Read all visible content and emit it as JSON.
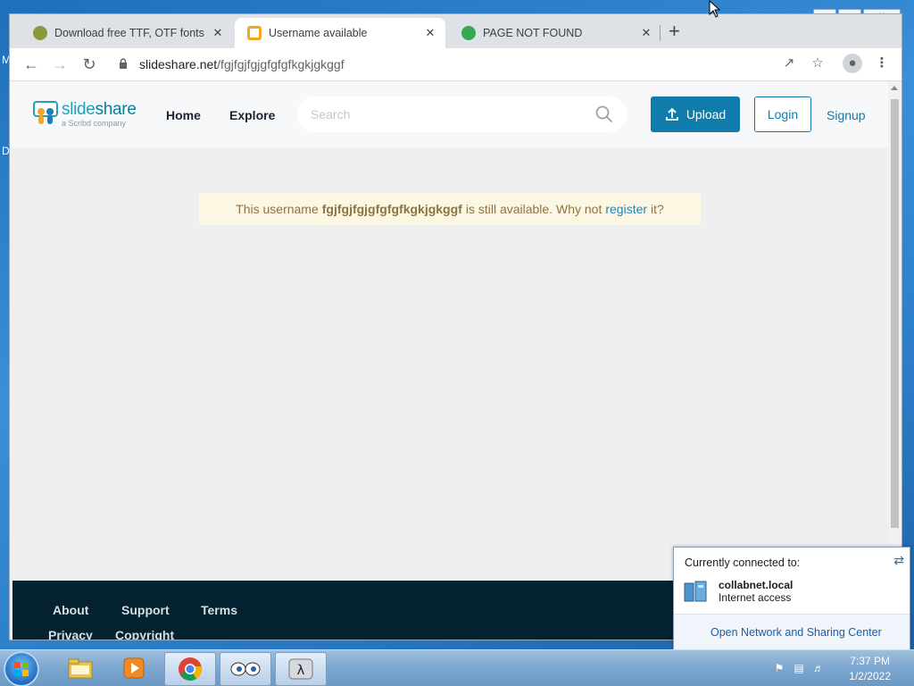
{
  "desktop": {
    "left_letters": [
      "M",
      "D"
    ]
  },
  "browser": {
    "tabs": [
      {
        "title": "Download free TTF, OTF fonts | C",
        "favicon_color": "#8a9a3a",
        "active": false
      },
      {
        "title": "Username available",
        "favicon_color": "#f5a623",
        "active": true
      },
      {
        "title": "PAGE NOT FOUND",
        "favicon_color": "#34a853",
        "active": false
      }
    ],
    "new_tab": "+",
    "url_domain": "slideshare.net",
    "url_path": "/fgjfgjfgjgfgfgfkgkjgkggf"
  },
  "slideshare": {
    "logo_word_a": "slide",
    "logo_word_b": "share",
    "logo_sub": "a Scribd company",
    "nav": [
      "Home",
      "Explore"
    ],
    "search_placeholder": "Search",
    "upload_label": "Upload",
    "login_label": "Login",
    "signup_label": "Signup",
    "notice": {
      "prefix": "This username",
      "username": "fgjfgjfgjgfgfgfkgkjgkggf",
      "middle": "is still available. Why not",
      "link": "register",
      "suffix": "it?"
    },
    "footer": [
      "About",
      "Support",
      "Terms",
      "Privacy",
      "Copyright"
    ],
    "brand_color": "#0f7cac"
  },
  "popup": {
    "header": "Currently connected to:",
    "network_name": "collabnet.local",
    "network_status": "Internet access",
    "link": "Open Network and Sharing Center"
  },
  "taskbar": {
    "time": "7:37 PM",
    "date": "1/2/2022",
    "apps": [
      "explorer-icon",
      "media-player-icon",
      "chrome-icon",
      "eyes-icon",
      "lambda-icon"
    ]
  }
}
